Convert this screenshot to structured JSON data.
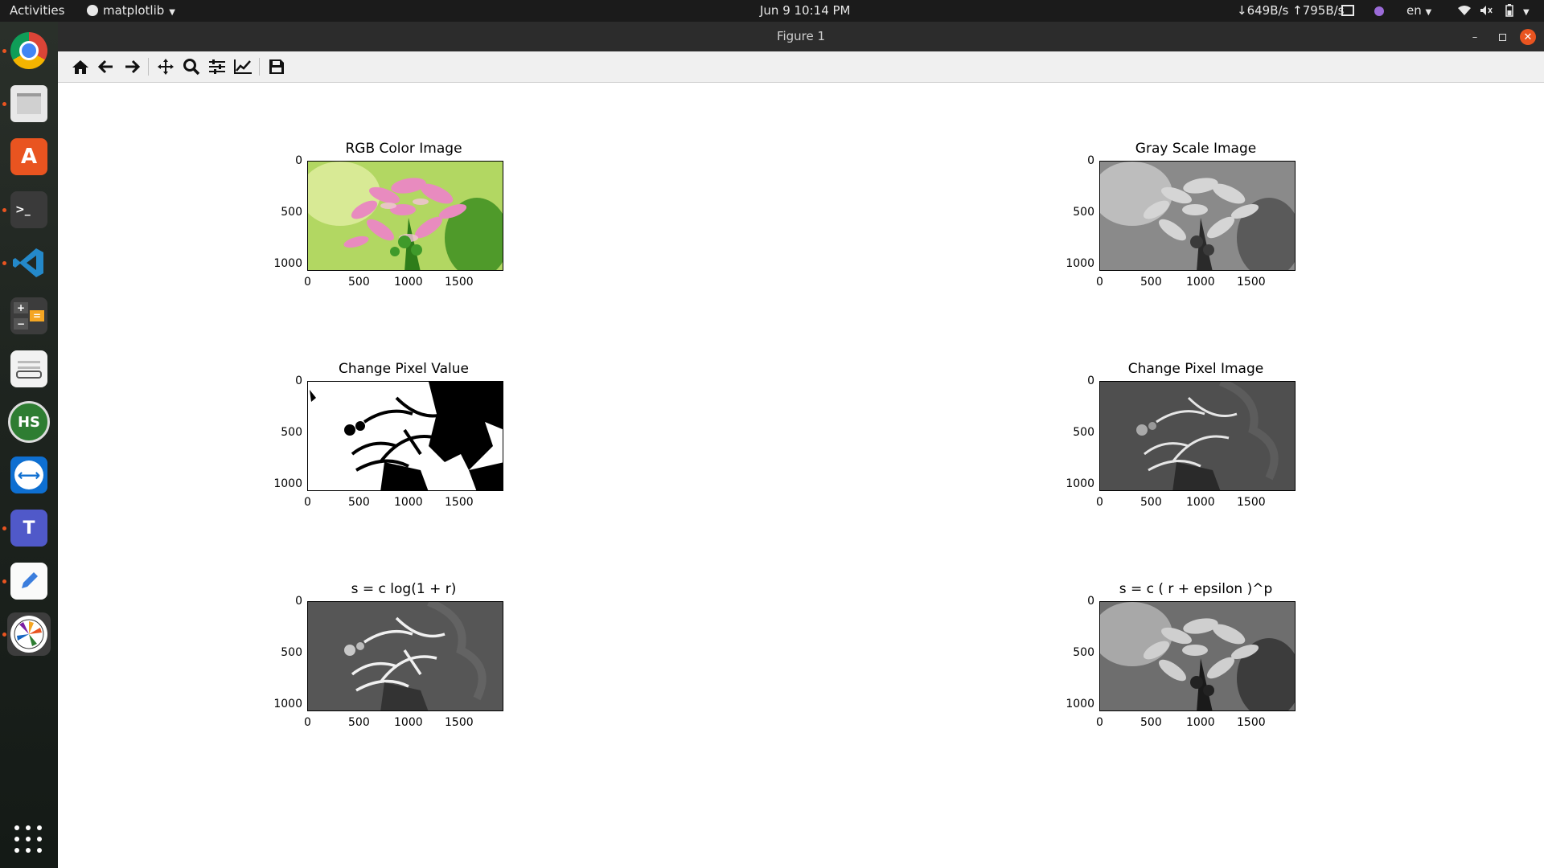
{
  "topbar": {
    "activities": "Activities",
    "app_name": "matplotlib",
    "datetime": "Jun 9  10:14 PM",
    "net_speed": "↓649B/s ↑795B/s",
    "language": "en"
  },
  "window": {
    "title": "Figure 1"
  },
  "toolbar": {
    "tools": [
      "home-icon",
      "back-icon",
      "forward-icon",
      "pan-icon",
      "zoom-icon",
      "configure-subplots-icon",
      "edit-axes-icon",
      "save-icon"
    ]
  },
  "dock": {
    "apps": [
      "chrome",
      "files",
      "app-center",
      "terminal",
      "vscode",
      "calculator",
      "document-viewer",
      "hs",
      "teamviewer",
      "teams",
      "text-editor",
      "matplotlib"
    ]
  },
  "subplots": [
    {
      "title": "RGB Color Image",
      "kind": "rgb"
    },
    {
      "title": "Gray Scale Image",
      "kind": "gray"
    },
    {
      "title": "Change Pixel Value",
      "kind": "binary"
    },
    {
      "title": "Change Pixel Image",
      "kind": "dark"
    },
    {
      "title": "s = c log(1 + r)",
      "kind": "log"
    },
    {
      "title": "s = c ( r + epsilon )^p",
      "kind": "gamma"
    }
  ],
  "axes": {
    "x_ticks": [
      "0",
      "500",
      "1000",
      "1500"
    ],
    "y_ticks": [
      "0",
      "500",
      "1000"
    ]
  }
}
